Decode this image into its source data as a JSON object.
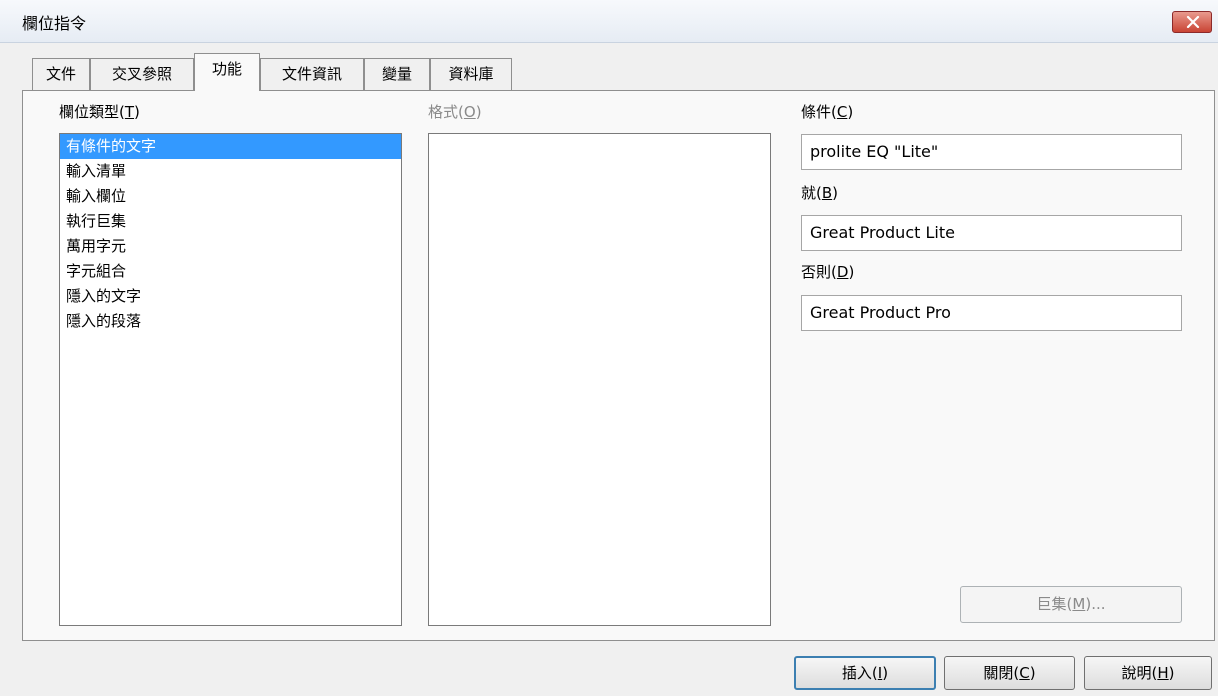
{
  "window": {
    "title": "欄位指令"
  },
  "tabs": [
    {
      "label": "文件"
    },
    {
      "label": "交叉參照"
    },
    {
      "label": "功能",
      "active": true
    },
    {
      "label": "文件資訊"
    },
    {
      "label": "變量"
    },
    {
      "label": "資料庫"
    }
  ],
  "field_types": {
    "label": "欄位類型",
    "mnemonic": "T",
    "items": [
      "有條件的文字",
      "輸入清單",
      "輸入欄位",
      "執行巨集",
      "萬用字元",
      "字元組合",
      "隱入的文字",
      "隱入的段落"
    ],
    "selected_index": 0
  },
  "format": {
    "label": "格式",
    "mnemonic": "O"
  },
  "condition": {
    "label": "條件",
    "mnemonic": "C",
    "value": "prolite EQ \"Lite\""
  },
  "then": {
    "label": "就",
    "mnemonic": "B",
    "value": "Great Product Lite"
  },
  "else": {
    "label": "否則",
    "mnemonic": "D",
    "value": "Great Product Pro"
  },
  "macro_button": {
    "label": "巨集",
    "mnemonic": "M",
    "suffix": "..."
  },
  "buttons": {
    "insert": {
      "label": "插入",
      "mnemonic": "I"
    },
    "close": {
      "label": "關閉",
      "mnemonic": "C"
    },
    "help": {
      "label": "說明",
      "mnemonic": "H"
    }
  },
  "colors": {
    "selection": "#3399ff",
    "close_button": "#c94434"
  },
  "icons": {
    "close": "close-x-icon"
  }
}
